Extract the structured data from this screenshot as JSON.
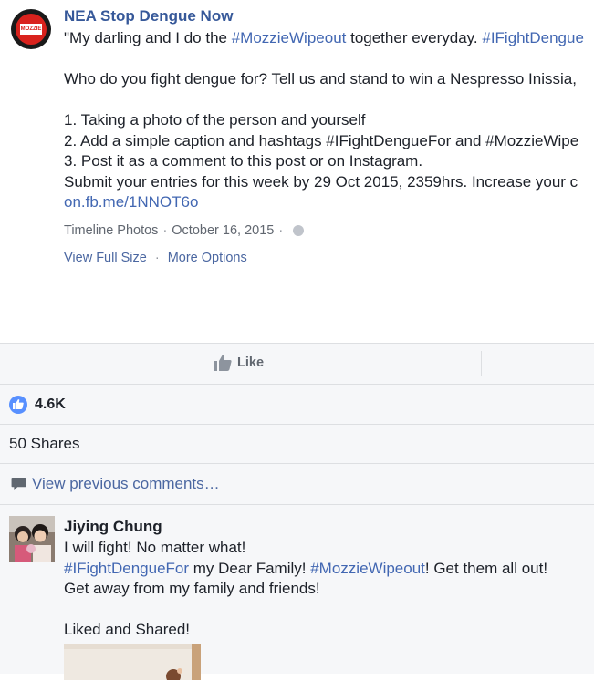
{
  "post": {
    "page_name": "NEA Stop Dengue Now",
    "avatar_text": "MOZZIE",
    "line1_a": "\"My darling and I do the ",
    "line1_tag1": "#MozzieWipeout",
    "line1_b": " together everyday. ",
    "line1_tag2": "#IFightDengue",
    "line2": "Who do you fight dengue for? Tell us and stand to win a Nespresso Inissia,",
    "line3": "1. Taking a photo of the person and yourself",
    "line4": "2. Add a simple caption and hashtags #IFightDengueFor and #MozzieWipe",
    "line5": "3. Post it as a comment to this post or on Instagram.",
    "line6": "Submit your entries for this week by 29 Oct 2015, 2359hrs. Increase your c",
    "link": "on.fb.me/1NNOT6o",
    "meta_source": "Timeline Photos",
    "meta_date": "October 16, 2015",
    "view_full_size": "View Full Size",
    "more_options": "More Options"
  },
  "actions": {
    "like_label": "Like"
  },
  "reactions": {
    "like_count": "4.6K"
  },
  "shares": {
    "label": "50 Shares"
  },
  "comments": {
    "view_previous": "View previous comments…",
    "items": [
      {
        "author": "Jiying Chung",
        "line1": "I will fight! No matter what!",
        "line2_tag1": "#IFightDengueFor",
        "line2_a": " my Dear Family! ",
        "line2_tag2": "#MozzieWipeout",
        "line2_b": "! Get them all out!",
        "line3": "Get away from my family and friends!",
        "line4": "Liked and Shared!"
      }
    ]
  },
  "colors": {
    "link_blue": "#365899",
    "hashtag_blue": "#4267b2",
    "like_blue": "#5890ff",
    "panel_bg": "#f6f7f9"
  },
  "icons": {
    "avatar": "nea-logo",
    "like": "thumbs-up-icon",
    "reaction": "like-reaction-icon",
    "comment": "comment-bubble-icon",
    "privacy": "globe-icon"
  }
}
